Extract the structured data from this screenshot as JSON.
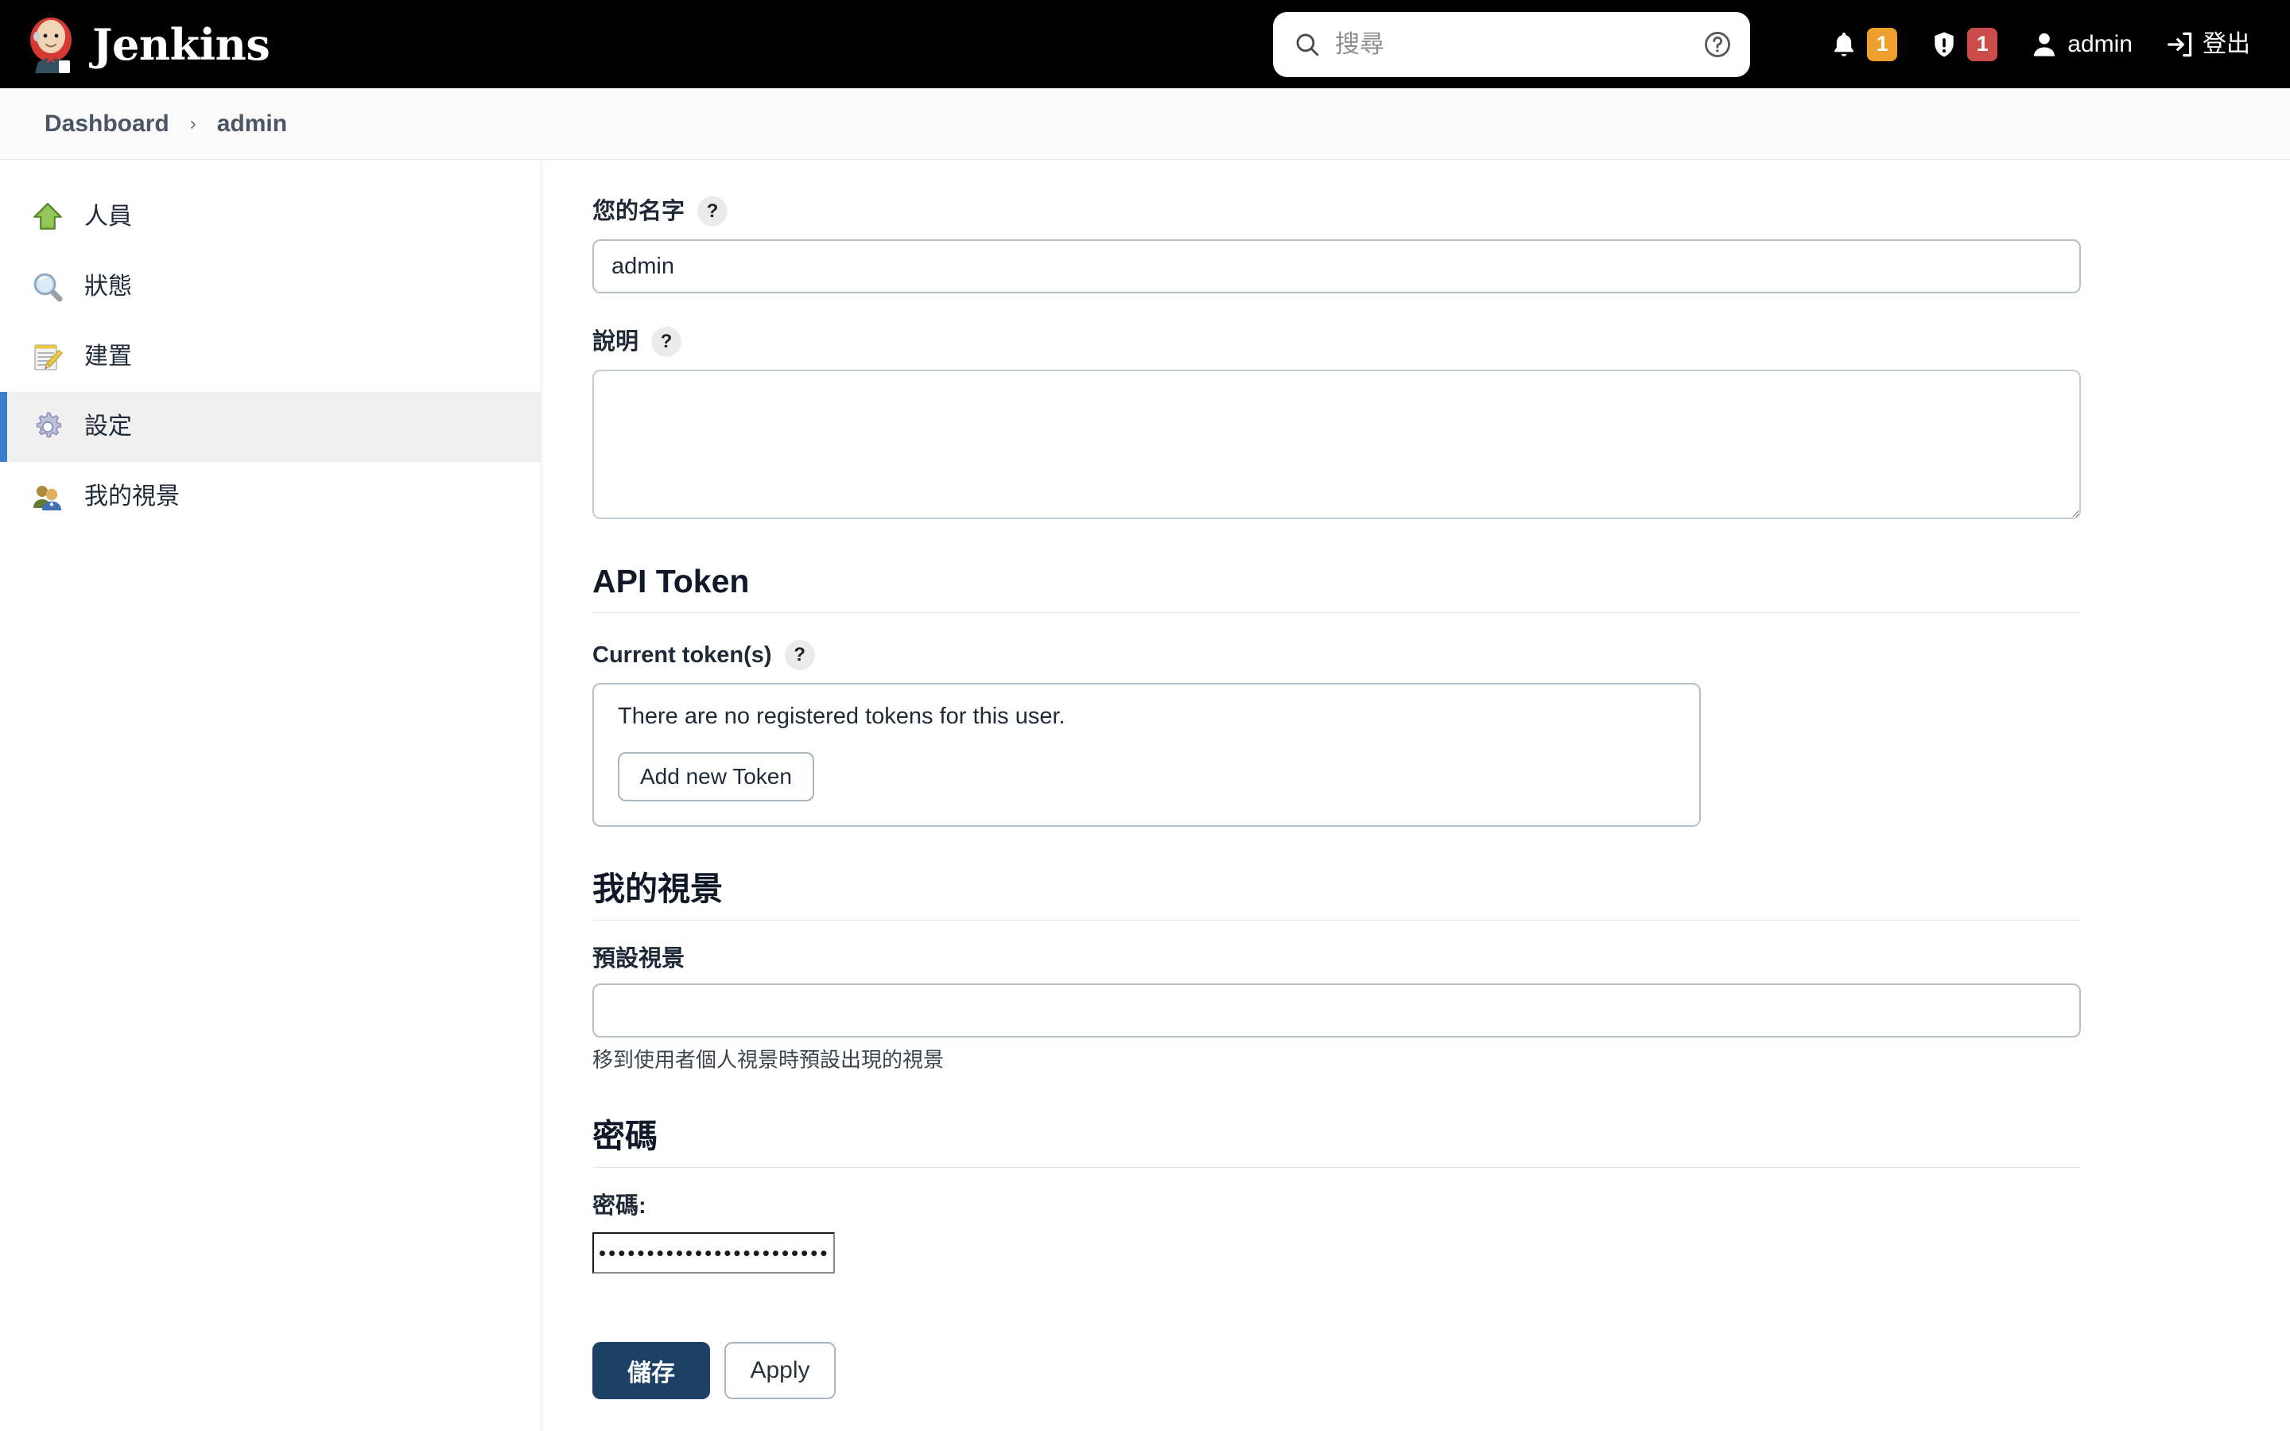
{
  "header": {
    "brand_name": "Jenkins",
    "brand_logo_icon": "jenkins-butler-logo",
    "search": {
      "icon": "search-icon",
      "placeholder": "搜尋",
      "value": "",
      "help_icon": "question-circle-icon"
    },
    "notifications": {
      "icon": "bell-icon",
      "count": "1",
      "badge_color": "#EE9F30"
    },
    "security": {
      "icon": "shield-exclamation-icon",
      "count": "1",
      "badge_color": "#CC4C4C"
    },
    "user": {
      "icon": "person-icon",
      "label": "admin"
    },
    "logout": {
      "icon": "logout-icon",
      "label": "登出"
    }
  },
  "breadcrumb": {
    "items": [
      {
        "label": "Dashboard"
      },
      {
        "label": "admin"
      }
    ],
    "separator": "›"
  },
  "sidebar": {
    "items": [
      {
        "label": "人員",
        "icon": "green-up-arrow-icon",
        "active": false
      },
      {
        "label": "狀態",
        "icon": "magnifier-icon",
        "active": false
      },
      {
        "label": "建置",
        "icon": "notepad-pencil-icon",
        "active": false
      },
      {
        "label": "設定",
        "icon": "gear-icon",
        "active": true
      },
      {
        "label": "我的視景",
        "icon": "people-icon",
        "active": false
      }
    ],
    "active_indicator_color": "#3a7dc9"
  },
  "main": {
    "full_name": {
      "label": "您的名字",
      "help": "?",
      "value": "admin",
      "placeholder": ""
    },
    "description": {
      "label": "說明",
      "help": "?",
      "value": "",
      "placeholder": ""
    },
    "api_token": {
      "heading": "API Token",
      "current_tokens_label": "Current token(s)",
      "help": "?",
      "empty_message": "There are no registered tokens for this user.",
      "add_button": "Add new Token"
    },
    "my_views": {
      "heading": "我的視景",
      "default_view_label": "預設視景",
      "default_view_value": "",
      "default_view_placeholder": "",
      "hint": "移到使用者個人視景時預設出現的視景"
    },
    "password": {
      "heading": "密碼",
      "label": "密碼:",
      "value": "••••••••••••••••••••••••••••••••"
    },
    "actions": {
      "save_label": "儲存",
      "apply_label": "Apply",
      "save_color": "#1c4066"
    }
  }
}
